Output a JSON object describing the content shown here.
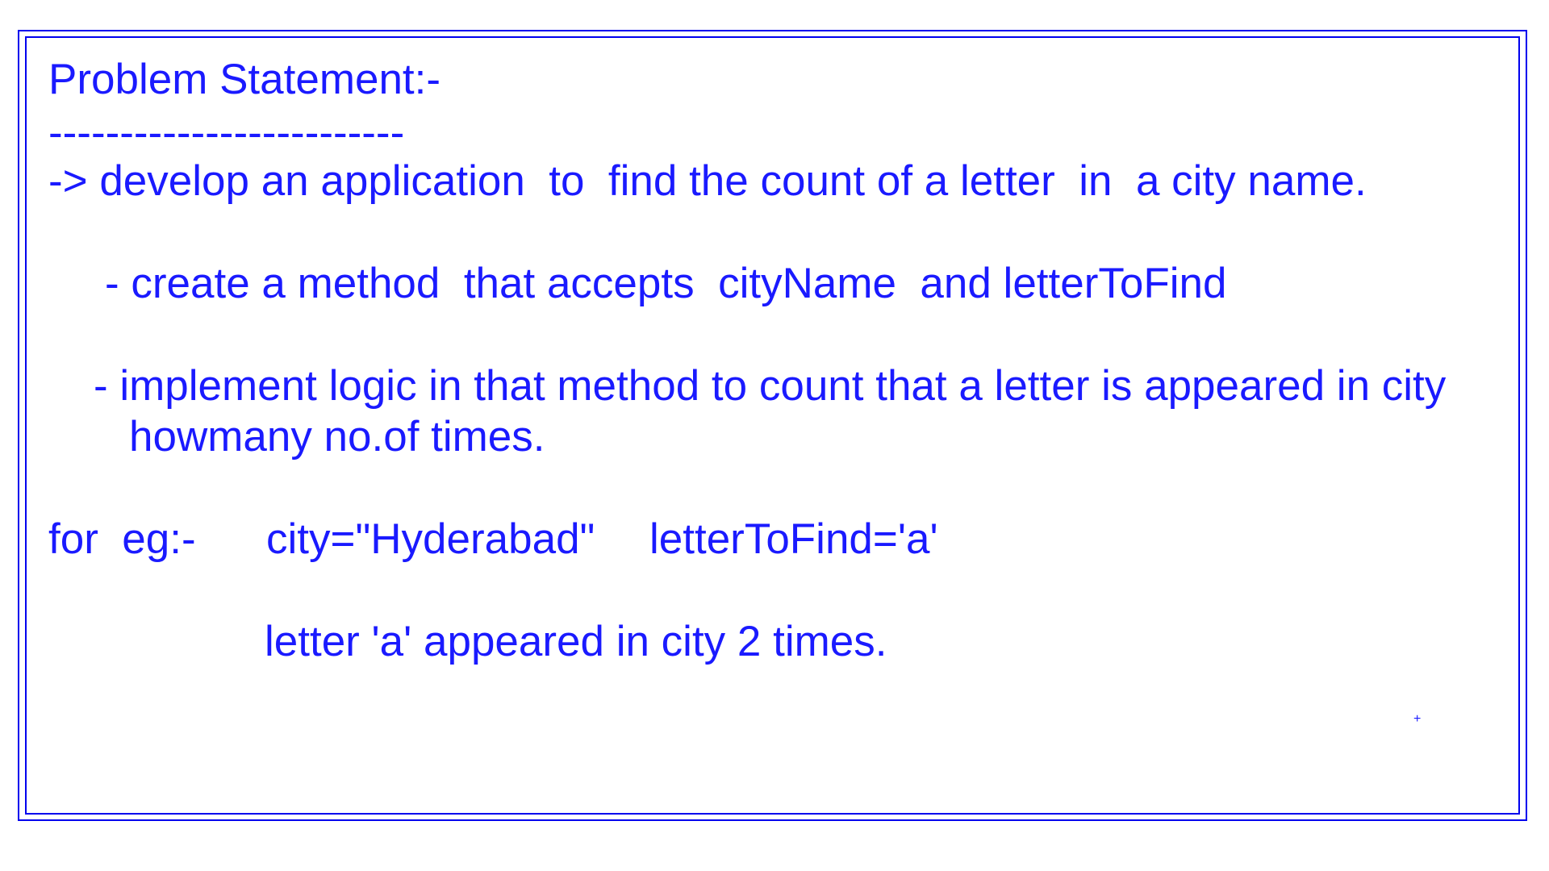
{
  "document": {
    "heading": "Problem Statement:-",
    "underline": "-------------------------",
    "task": "-> develop an application  to  find the count of a letter  in  a city name.",
    "step1": "- create a method  that accepts  cityName  and letterToFind",
    "step2_line1": "- implement logic in that method to count that a letter is appeared in city",
    "step2_line2": "howmany no.of times.",
    "example_label": "for  eg:-",
    "example_city": "city=\"Hyderabad\"",
    "example_letter": "letterToFind='a'",
    "example_result": "letter 'a' appeared in city 2 times.",
    "cursor_mark": "+"
  }
}
